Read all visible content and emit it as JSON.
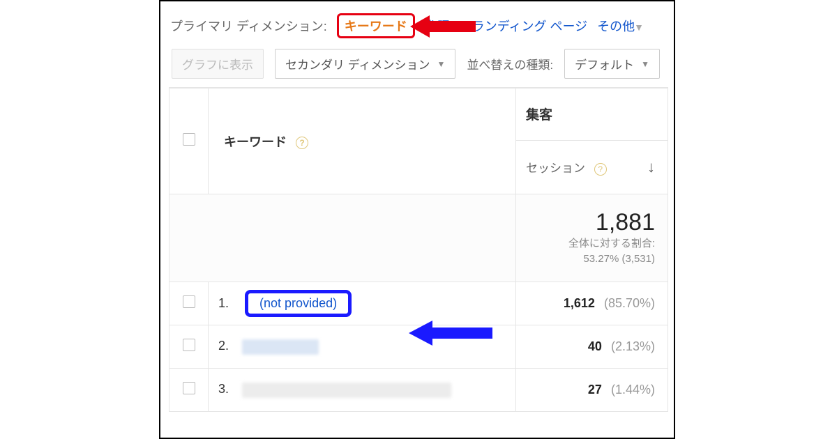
{
  "primary_dimension": {
    "label": "プライマリ ディメンション:",
    "active": "キーワード",
    "tabs": [
      "参照元",
      "ランディング ページ",
      "その他"
    ]
  },
  "toolbar": {
    "graph_btn": "グラフに表示",
    "secondary_dim": "セカンダリ ディメンション",
    "sort_label": "並べ替えの種類:",
    "sort_default": "デフォルト"
  },
  "headers": {
    "keyword": "キーワード",
    "acquisition": "集客",
    "sessions": "セッション"
  },
  "summary": {
    "total": "1,881",
    "subtext1": "全体に対する割合:",
    "subtext2": "53.27% (3,531)"
  },
  "rows": [
    {
      "n": "1.",
      "keyword": "(not provided)",
      "value": "1,612",
      "pct": "(85.70%)",
      "highlight": true,
      "blurred": false
    },
    {
      "n": "2.",
      "keyword": "",
      "value": "40",
      "pct": "(2.13%)",
      "highlight": false,
      "blurred": true
    },
    {
      "n": "3.",
      "keyword": "",
      "value": "27",
      "pct": "(1.44%)",
      "highlight": false,
      "blurred": true
    }
  ]
}
